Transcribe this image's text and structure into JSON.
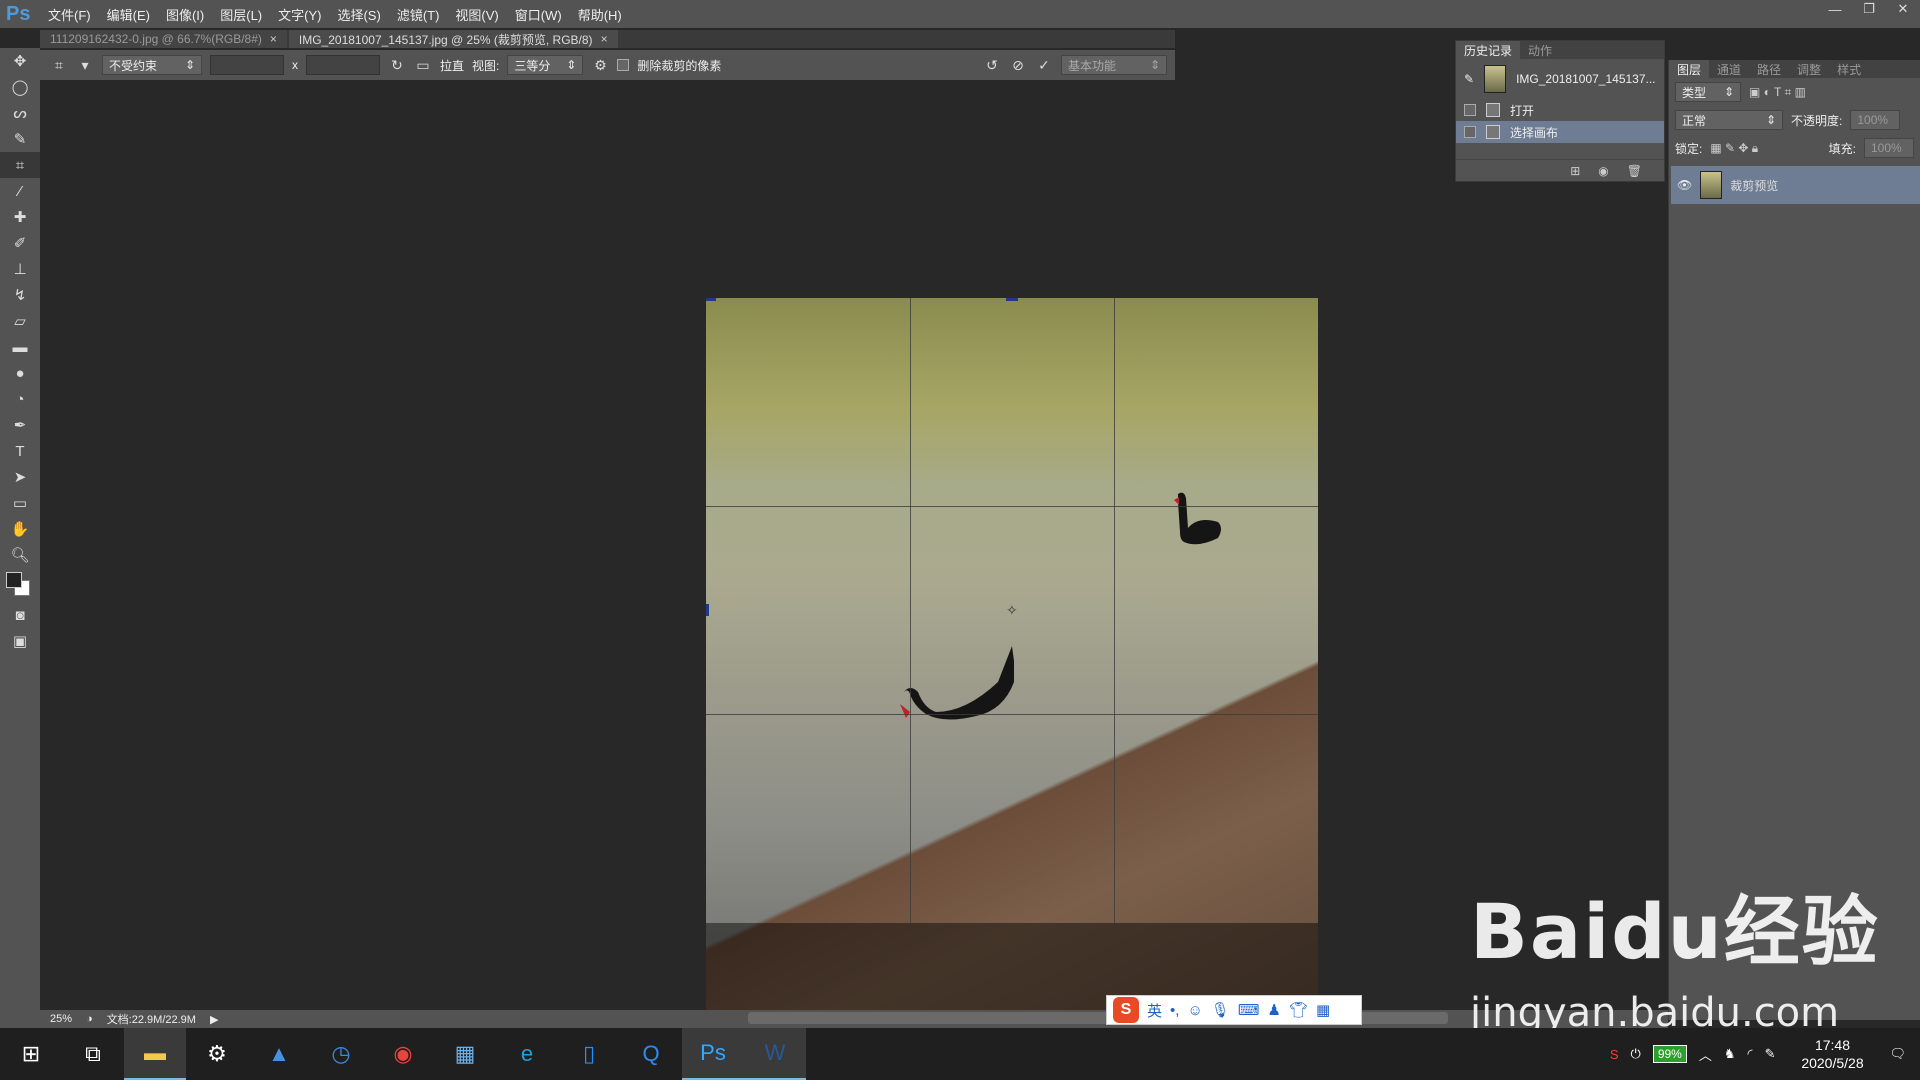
{
  "app": {
    "logo": "Ps"
  },
  "menu": [
    "文件(F)",
    "编辑(E)",
    "图像(I)",
    "图层(L)",
    "文字(Y)",
    "选择(S)",
    "滤镜(T)",
    "视图(V)",
    "窗口(W)",
    "帮助(H)"
  ],
  "tabs": [
    {
      "label": "111209162432-0.jpg @ 66.7%(RGB/8#)",
      "close": "×"
    },
    {
      "label": "IMG_20181007_145137.jpg @ 25% (裁剪预览, RGB/8)",
      "close": "×"
    }
  ],
  "options": {
    "ratio": "不受约束",
    "times": "x",
    "straighten": "拉直",
    "view_label": "视图:",
    "view_value": "三等分",
    "delete_pixels": "删除裁剪的像素",
    "workspace": "基本功能"
  },
  "history": {
    "tabs": [
      "历史记录",
      "动作"
    ],
    "snapshot": "IMG_20181007_145137...",
    "items": [
      "打开",
      "选择画布"
    ]
  },
  "layers": {
    "tabs": [
      "图层",
      "通道",
      "路径",
      "调整",
      "样式"
    ],
    "kind": "类型",
    "blend": "正常",
    "opacity_label": "不透明度:",
    "opacity": "100%",
    "lock_label": "锁定:",
    "fill_label": "填充:",
    "fill": "100%",
    "layer_name": "裁剪预览"
  },
  "status": {
    "zoom": "25%",
    "doc": "文档:22.9M/22.9M"
  },
  "ime": {
    "lang": "英"
  },
  "watermark": {
    "main": "Baidu经验",
    "sub": "jingyan.baidu.com"
  },
  "taskbar": {
    "battery": "99%",
    "time": "17:48",
    "date": "2020/5/28"
  }
}
